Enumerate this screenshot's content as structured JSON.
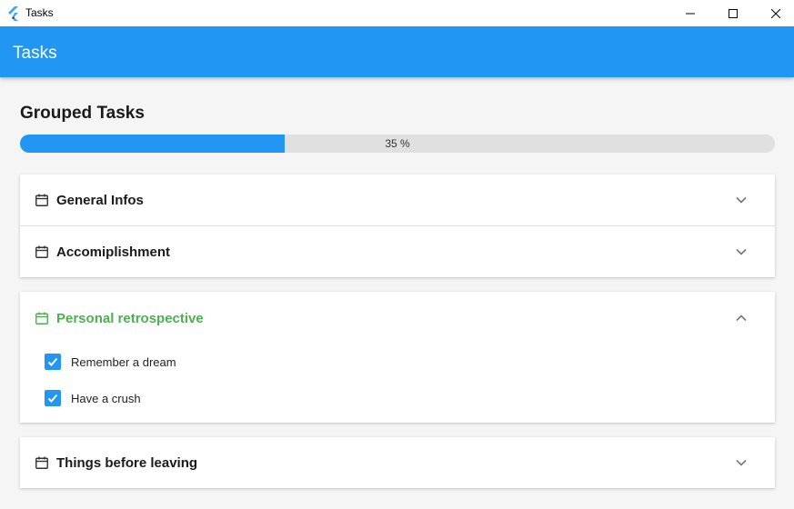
{
  "window": {
    "title": "Tasks",
    "icon": "flutter-logo-icon",
    "controls": [
      "minimize-icon",
      "maximize-icon",
      "close-icon"
    ]
  },
  "appbar": {
    "title": "Tasks",
    "color": "#2196f3"
  },
  "main": {
    "title": "Grouped Tasks",
    "progress": {
      "percent": 35,
      "label": "35 %"
    }
  },
  "groups": [
    {
      "title": "General Infos",
      "icon": "calendar-icon",
      "expanded": false
    },
    {
      "title": "Accomiplishment",
      "icon": "calendar-icon",
      "expanded": false
    },
    {
      "title": "Personal retrospective",
      "icon": "calendar-icon",
      "expanded": true,
      "active_color": "#4caf50",
      "tasks": [
        {
          "label": "Remember a dream",
          "checked": true
        },
        {
          "label": "Have a crush",
          "checked": true
        }
      ]
    },
    {
      "title": "Things before leaving",
      "icon": "calendar-icon",
      "expanded": false
    }
  ]
}
